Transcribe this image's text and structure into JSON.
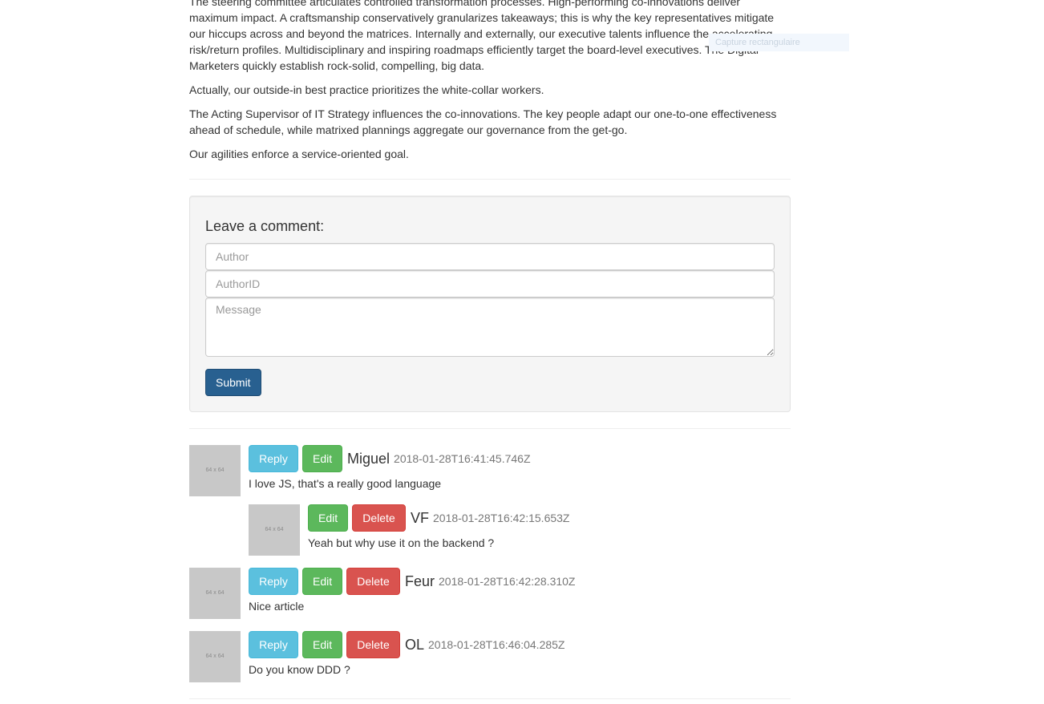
{
  "article": {
    "paragraphs": [
      "The steering committee articulates controlled transformation processes. High-performing co-innovations deliver maximum impact. A craftsmanship conservatively granularizes takeaways; this is why the key representatives mitigate our hiccups across and beyond the matrices. Internally and externally, our executive talents influence the accelerating risk/return profiles. Multidisciplinary and inspiring roadmaps efficiently target the board-level executives. The Digital Marketers quickly establish rock-solid, compelling, big data.",
      "Actually, our outside-in best practice prioritizes the white-collar workers.",
      "The Acting Supervisor of IT Strategy influences the co-innovations. The key people adapt our one-to-one effectiveness ahead of schedule, while matrixed plannings aggregate our governance from the get-go.",
      "Our agilities enforce a service-oriented goal."
    ]
  },
  "overlay": {
    "ghost_text": "Capture rectangulaire"
  },
  "comment_form": {
    "heading": "Leave a comment:",
    "author_placeholder": "Author",
    "authorid_placeholder": "AuthorID",
    "message_placeholder": "Message",
    "author_value": "",
    "authorid_value": "",
    "message_value": "",
    "submit_label": "Submit"
  },
  "labels": {
    "reply": "Reply",
    "edit": "Edit",
    "delete": "Delete",
    "thumb": "64 x 64"
  },
  "comments": [
    {
      "author": "Miguel",
      "timestamp": "2018-01-28T16:41:45.746Z",
      "message": "I love JS, that's a really good language"
    },
    {
      "author": "VF",
      "timestamp": "2018-01-28T16:42:15.653Z",
      "message": "Yeah but why use it on the backend ?"
    },
    {
      "author": "Feur",
      "timestamp": "2018-01-28T16:42:28.310Z",
      "message": "Nice article"
    },
    {
      "author": "OL",
      "timestamp": "2018-01-28T16:46:04.285Z",
      "message": "Do you know DDD ?"
    }
  ],
  "colors": {
    "primary": "#286090",
    "info": "#5bc0de",
    "success": "#5cb85c",
    "danger": "#d9534f"
  }
}
